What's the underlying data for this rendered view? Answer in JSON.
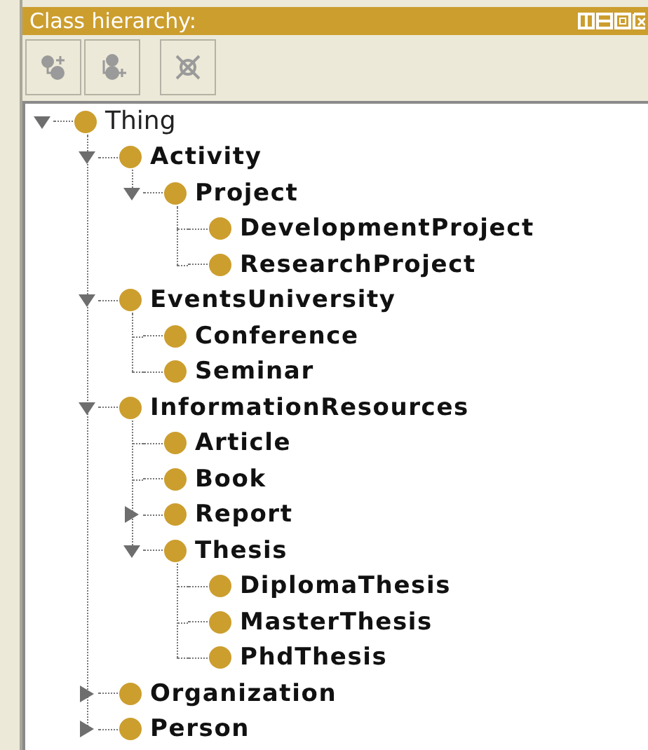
{
  "panel": {
    "title": "Class hierarchy:"
  },
  "toolbar": [
    {
      "kind": "add-subclass",
      "disabled": true
    },
    {
      "kind": "add-sibling",
      "disabled": true
    },
    {
      "kind": "delete",
      "disabled": true
    }
  ],
  "tree": [
    {
      "label": "Thing",
      "expanded": true,
      "children": [
        {
          "label": "Activity",
          "expanded": true,
          "children": [
            {
              "label": "Project",
              "expanded": true,
              "children": [
                {
                  "label": "DevelopmentProject"
                },
                {
                  "label": "ResearchProject"
                }
              ]
            }
          ]
        },
        {
          "label": "EventsUniversity",
          "expanded": true,
          "children": [
            {
              "label": "Conference"
            },
            {
              "label": "Seminar"
            }
          ]
        },
        {
          "label": "InformationResources",
          "expanded": true,
          "children": [
            {
              "label": "Article"
            },
            {
              "label": "Book"
            },
            {
              "label": "Report",
              "expanded": false
            },
            {
              "label": "Thesis",
              "expanded": true,
              "children": [
                {
                  "label": "DiplomaThesis"
                },
                {
                  "label": "MasterThesis"
                },
                {
                  "label": "PhdThesis"
                }
              ]
            }
          ]
        },
        {
          "label": "Organization",
          "expanded": false
        },
        {
          "label": "Person",
          "expanded": false
        }
      ]
    }
  ]
}
